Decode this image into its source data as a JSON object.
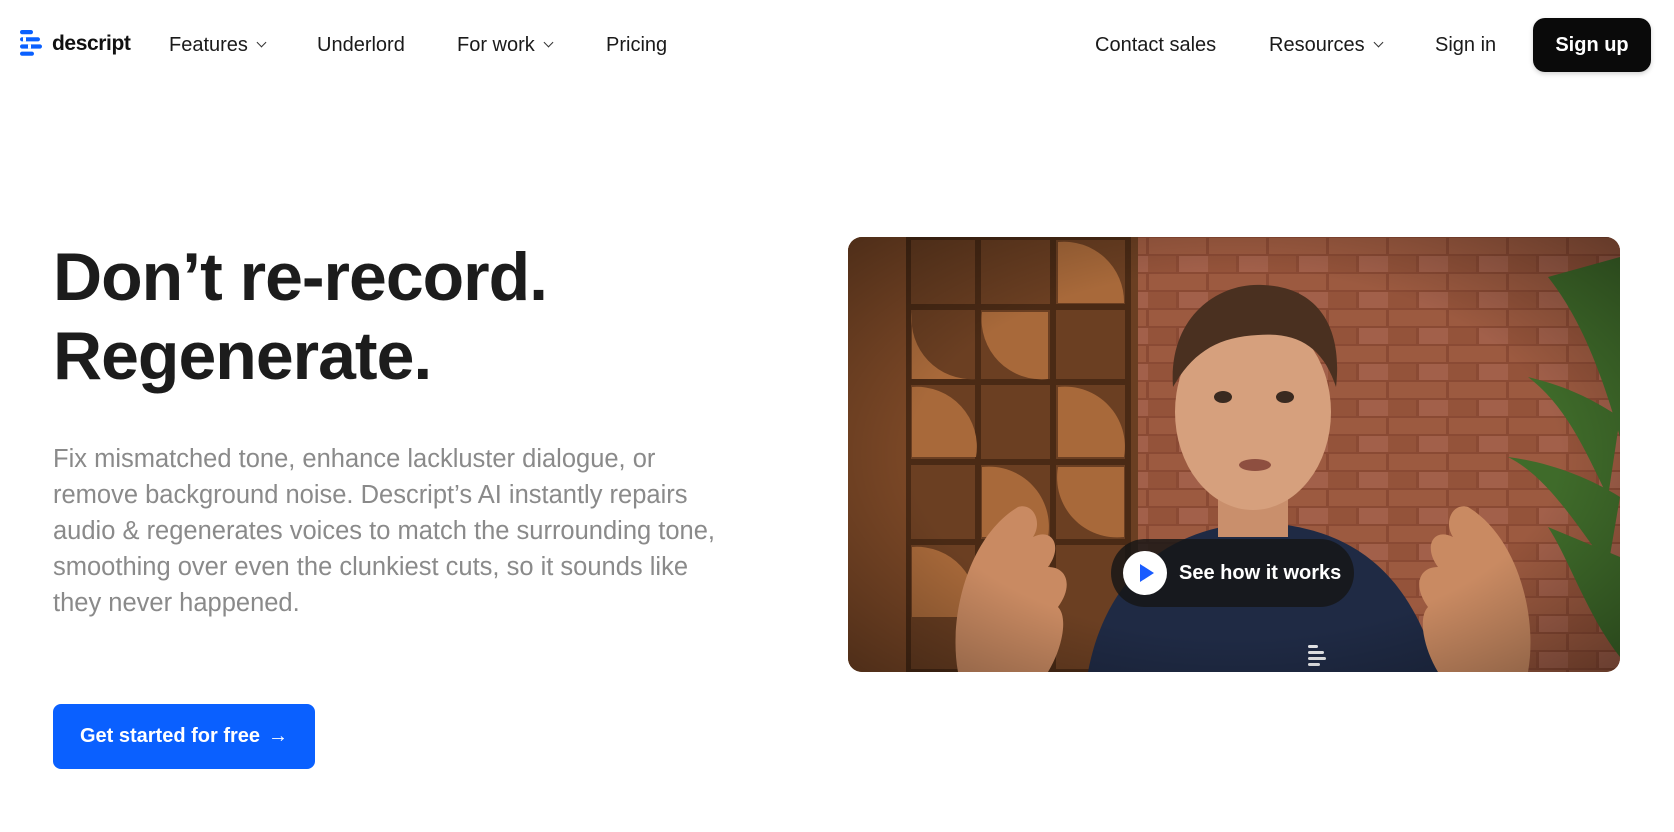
{
  "brand": {
    "name": "descript",
    "accent": "#0a60ff"
  },
  "nav": {
    "left": [
      {
        "label": "Features",
        "has_dropdown": true
      },
      {
        "label": "Underlord",
        "has_dropdown": false
      },
      {
        "label": "For work",
        "has_dropdown": true
      },
      {
        "label": "Pricing",
        "has_dropdown": false
      }
    ],
    "right": [
      {
        "label": "Contact sales",
        "has_dropdown": false
      },
      {
        "label": "Resources",
        "has_dropdown": true
      },
      {
        "label": "Sign in",
        "has_dropdown": false
      }
    ],
    "signup_label": "Sign up"
  },
  "hero": {
    "headline_line1": "Don’t re-record.",
    "headline_line2": "Regenerate.",
    "subtext": "Fix mismatched tone, enhance lackluster dialogue, or remove background noise. Descript’s AI instantly repairs audio & regenerates voices to match the surrounding tone, smoothing over even the clunkiest cuts, so it sounds like they never happened.",
    "cta_label": "Get started for free",
    "cta_arrow": "→"
  },
  "video": {
    "play_label": "See how it works",
    "icon": "play-icon"
  }
}
